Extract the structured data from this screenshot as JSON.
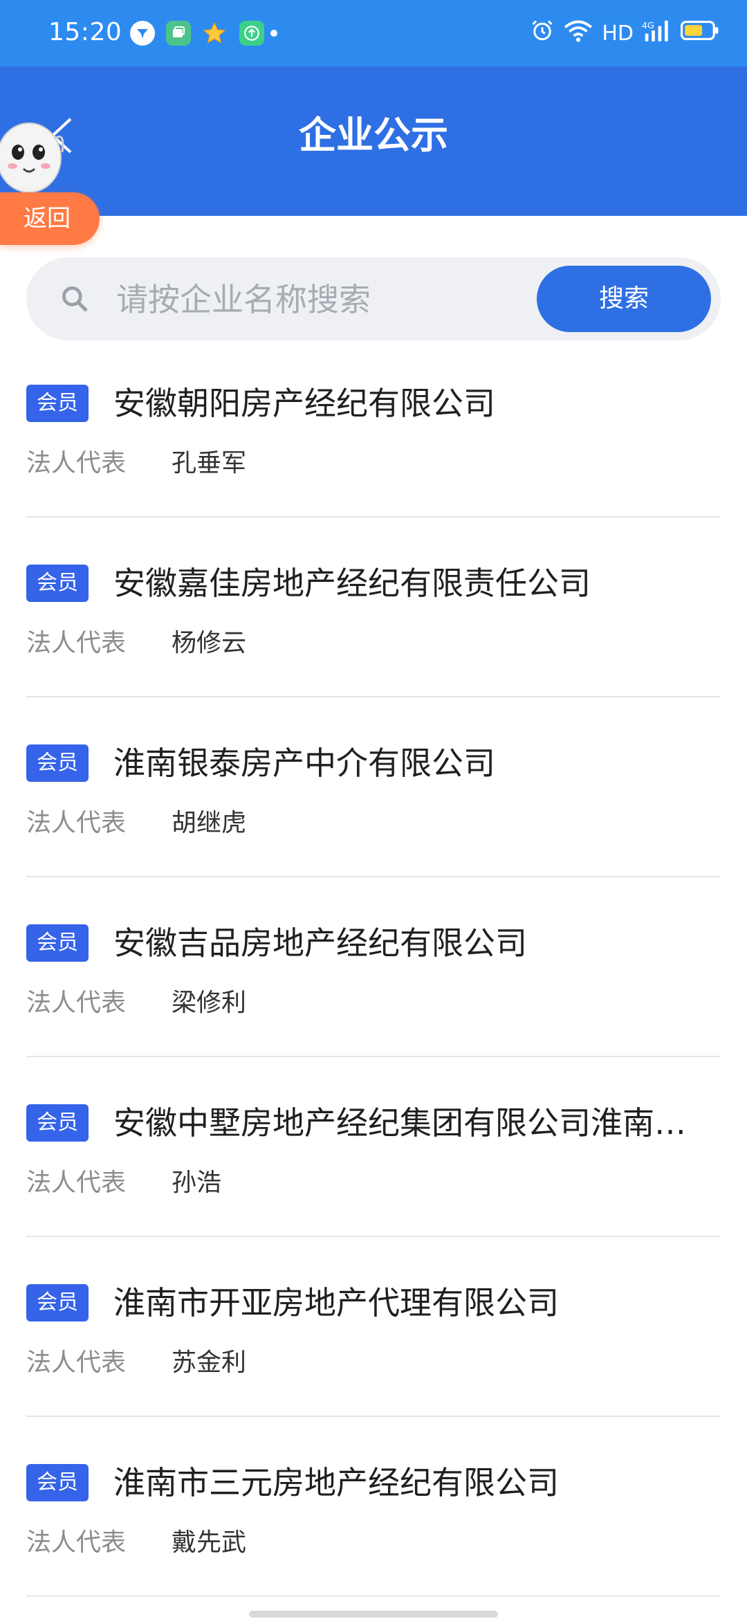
{
  "status_bar": {
    "time": "15:20",
    "network": "HD",
    "icons": [
      "message-app-icon",
      "gallery-app-icon",
      "star-app-icon",
      "upload-app-icon",
      "dot-icon",
      "alarm-icon",
      "wifi-icon",
      "signal-4g-icon",
      "battery-icon"
    ]
  },
  "header": {
    "title": "企业公示",
    "back_label": "返回"
  },
  "search": {
    "placeholder": "请按企业名称搜索",
    "button_label": "搜索"
  },
  "companies": [
    {
      "badge": "会员",
      "name": "安徽朝阳房产经纪有限公司",
      "rep_label": "法人代表",
      "rep_name": "孔垂军"
    },
    {
      "badge": "会员",
      "name": "安徽嘉佳房地产经纪有限责任公司",
      "rep_label": "法人代表",
      "rep_name": "杨修云"
    },
    {
      "badge": "会员",
      "name": "淮南银泰房产中介有限公司",
      "rep_label": "法人代表",
      "rep_name": "胡继虎"
    },
    {
      "badge": "会员",
      "name": "安徽吉品房地产经纪有限公司",
      "rep_label": "法人代表",
      "rep_name": "梁修利"
    },
    {
      "badge": "会员",
      "name": "安徽中墅房地产经纪集团有限公司淮南…",
      "rep_label": "法人代表",
      "rep_name": "孙浩"
    },
    {
      "badge": "会员",
      "name": "淮南市开亚房地产代理有限公司",
      "rep_label": "法人代表",
      "rep_name": "苏金利"
    },
    {
      "badge": "会员",
      "name": "淮南市三元房地产经纪有限公司",
      "rep_label": "法人代表",
      "rep_name": "戴先武"
    }
  ],
  "colors": {
    "status_bar": "#2d8bf0",
    "header": "#2f6fe4",
    "badge": "#3563e9",
    "back_pill": "#ff7a45"
  }
}
